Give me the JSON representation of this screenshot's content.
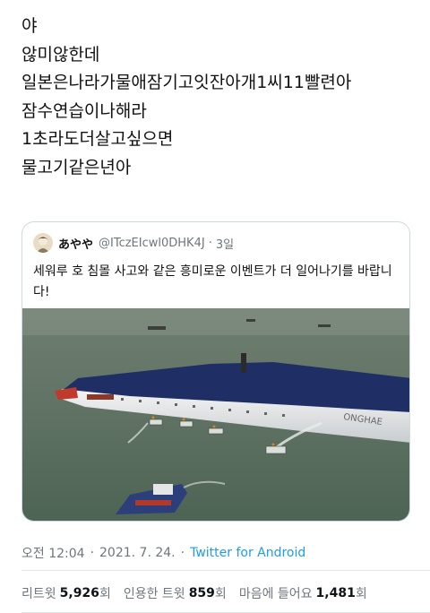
{
  "tweet": {
    "lines": [
      "야",
      "않미않한데",
      "일본은나라가물애잠기고잇잔아개1씨11빨련아",
      "잠수연습이나해라",
      "1초라도더살고싶으면",
      "물고기같은년아"
    ]
  },
  "quote": {
    "display_name": "あやや",
    "handle": "@ITczEIcwl0DHK4J",
    "separator": "·",
    "time": "3일",
    "text": "세워루 호 침몰 사고와 같은 흥미로운 이벤트가 더 일어나기를 바랍니다!",
    "image_icon": "capsized-ferry-photo"
  },
  "meta": {
    "time": "오전 12:04",
    "dot1": "·",
    "date": "2021. 7. 24.",
    "dot2": "·",
    "source": "Twitter for Android"
  },
  "stats": {
    "retweets_label": "리트윗",
    "retweets_count": "5,926",
    "retweets_unit": "회",
    "quotes_label": "인용한 트윗",
    "quotes_count": "859",
    "quotes_unit": "회",
    "likes_label": "마음에 들어요",
    "likes_count": "1,481",
    "likes_unit": "회"
  },
  "colors": {
    "link": "#1d9bf0",
    "muted": "#6e767d",
    "border": "#cfd9de"
  }
}
